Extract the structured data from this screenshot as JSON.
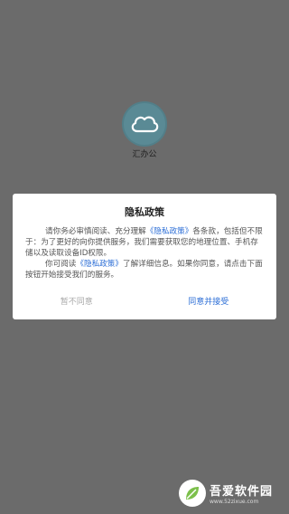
{
  "app": {
    "name": "汇办公",
    "icon": "cloud-icon",
    "icon_color": "#5a8a95"
  },
  "dialog": {
    "title": "隐私政策",
    "paragraph1": {
      "text_before": "请你务必审慎阅读、充分理解",
      "link": "《隐私政策》",
      "text_after": "各条款，包括但不限于：为了更好的向你提供服务，我们需要获取您的地理位置、手机存储以及读取设备ID权限。"
    },
    "paragraph2": {
      "text_before": "你可阅读",
      "link": "《隐私政策》",
      "text_after": "了解详细信息。如果你同意，请点击下面按钮开始接受我们的服务。"
    },
    "decline_label": "暂不同意",
    "accept_label": "同意并接受",
    "accent_color": "#2c6ed6"
  },
  "watermark": {
    "name": "吾爱软件园",
    "url": "www.52zixue.com"
  }
}
